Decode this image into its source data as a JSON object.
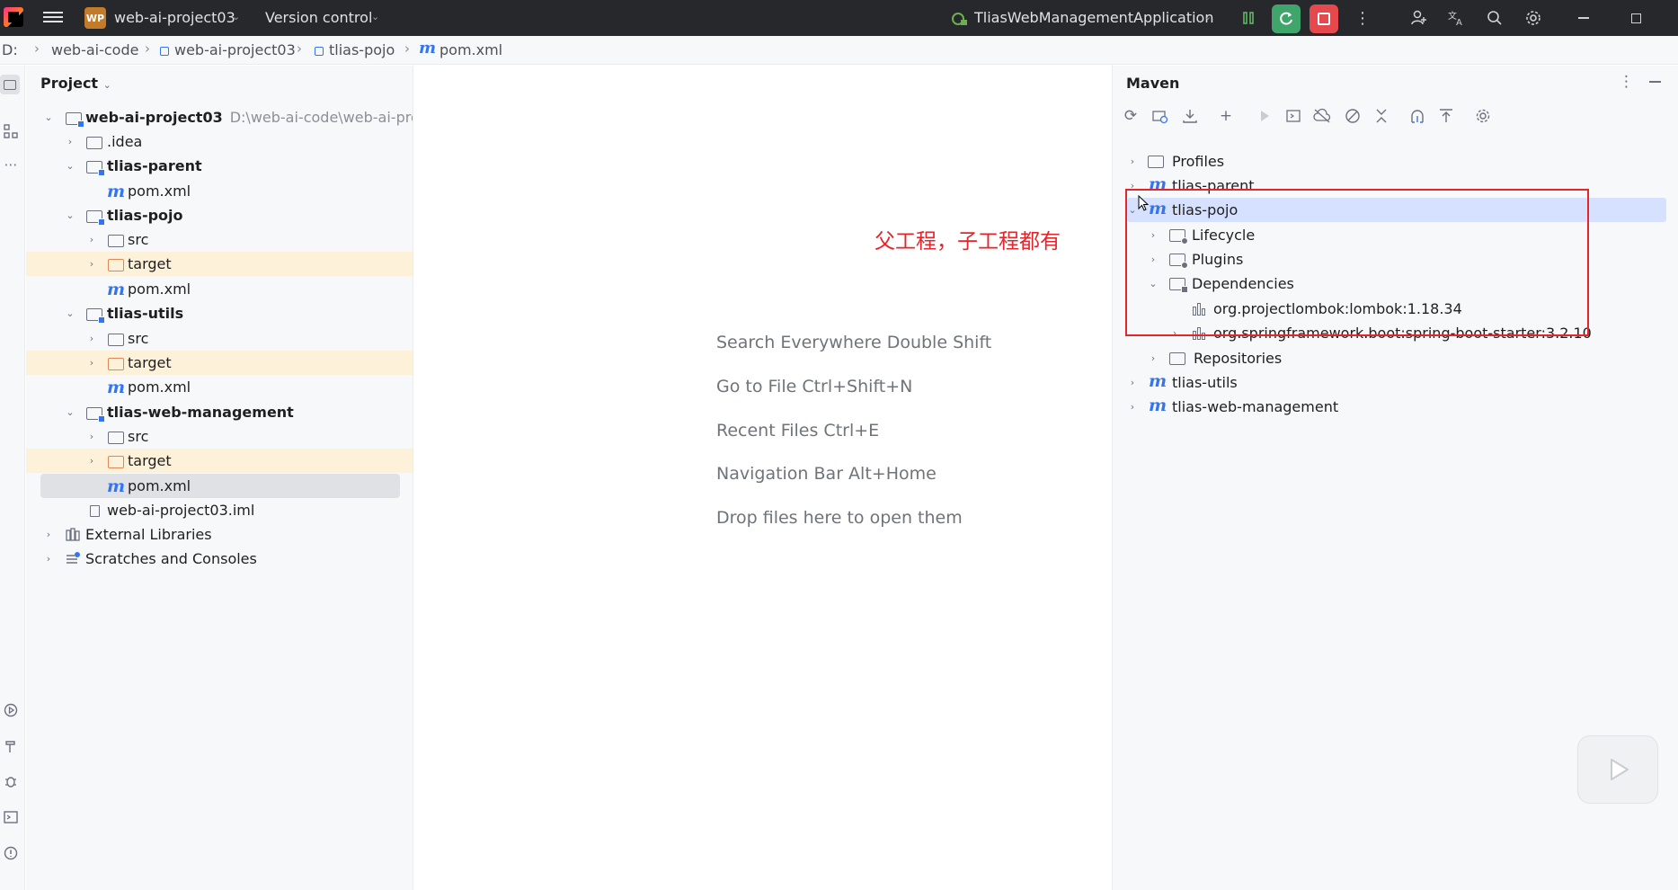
{
  "titlebar": {
    "project_badge": "WP",
    "project_name": "web-ai-project03",
    "version_control": "Version control",
    "run_config": "TliasWebManagementApplication"
  },
  "breadcrumb": {
    "items": [
      "D:",
      "web-ai-code",
      "web-ai-project03",
      "tlias-pojo",
      "pom.xml"
    ]
  },
  "project_panel": {
    "title": "Project",
    "rows": [
      {
        "label": "web-ai-project03",
        "path": "D:\\web-ai-code\\web-ai-proj"
      },
      {
        "label": ".idea"
      },
      {
        "label": "tlias-parent"
      },
      {
        "label": "pom.xml"
      },
      {
        "label": "tlias-pojo"
      },
      {
        "label": "src"
      },
      {
        "label": "target"
      },
      {
        "label": "pom.xml"
      },
      {
        "label": "tlias-utils"
      },
      {
        "label": "src"
      },
      {
        "label": "target"
      },
      {
        "label": "pom.xml"
      },
      {
        "label": "tlias-web-management"
      },
      {
        "label": "src"
      },
      {
        "label": "target"
      },
      {
        "label": "pom.xml"
      },
      {
        "label": "web-ai-project03.iml"
      },
      {
        "label": "External Libraries"
      },
      {
        "label": "Scratches and Consoles"
      }
    ]
  },
  "editor": {
    "hints": [
      "Search Everywhere Double Shift",
      "Go to File Ctrl+Shift+N",
      "Recent Files Ctrl+E",
      "Navigation Bar Alt+Home",
      "Drop files here to open them"
    ],
    "annotation": "父工程，子工程都有"
  },
  "maven_panel": {
    "title": "Maven",
    "rows": [
      {
        "label": "Profiles"
      },
      {
        "label": "tlias-parent"
      },
      {
        "label": "tlias-pojo"
      },
      {
        "label": "Lifecycle"
      },
      {
        "label": "Plugins"
      },
      {
        "label": "Dependencies"
      },
      {
        "label": "org.projectlombok:lombok:1.18.34"
      },
      {
        "label": "org.springframework.boot:spring-boot-starter:3.2.10"
      },
      {
        "label": "Repositories"
      },
      {
        "label": "tlias-utils"
      },
      {
        "label": "tlias-web-management"
      }
    ]
  },
  "colors": {
    "accent": "#3574f0",
    "annotation_red": "#e3262b",
    "run_green": "#3fa56b",
    "stop_red": "#e5484d",
    "target_highlight": "#fdf2d9"
  },
  "m_glyph": "m"
}
